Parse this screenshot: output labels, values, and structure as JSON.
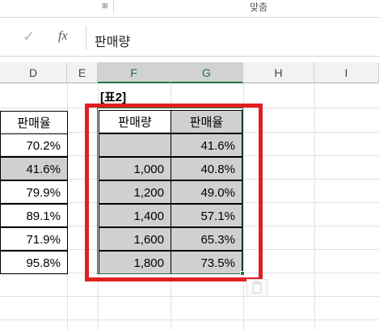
{
  "ribbon": {
    "group_label": "맞춤",
    "dialog_launcher": "⊞"
  },
  "formula_bar": {
    "confirm_icon": "✓",
    "fx_label": "fx",
    "value": "판매량"
  },
  "columns": [
    "D",
    "E",
    "F",
    "G",
    "H",
    "I"
  ],
  "table_title": "[표2]",
  "left_table": {
    "header": "판매율",
    "values": [
      "70.2%",
      "41.6%",
      "79.9%",
      "89.1%",
      "71.9%",
      "95.8%"
    ]
  },
  "right_table": {
    "headers": [
      "판매량",
      "판매율"
    ],
    "rows": [
      [
        "",
        "41.6%"
      ],
      [
        "1,000",
        "40.8%"
      ],
      [
        "1,200",
        "49.0%"
      ],
      [
        "1,400",
        "57.1%"
      ],
      [
        "1,600",
        "65.3%"
      ],
      [
        "1,800",
        "73.5%"
      ]
    ]
  }
}
